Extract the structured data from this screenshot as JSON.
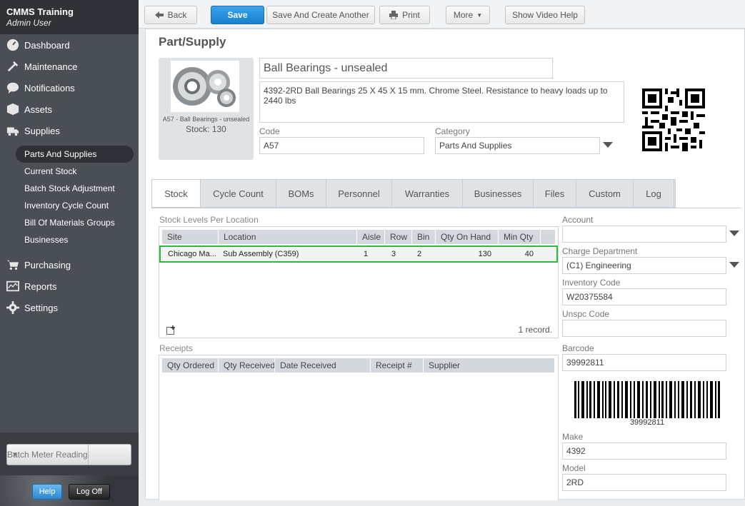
{
  "sidebar": {
    "app_name": "CMMS Training",
    "user": "Admin User",
    "nav": [
      {
        "label": "Dashboard",
        "icon": "dashboard-icon"
      },
      {
        "label": "Maintenance",
        "icon": "tools-icon"
      },
      {
        "label": "Notifications",
        "icon": "chat-bubble-icon"
      },
      {
        "label": "Assets",
        "icon": "box-icon"
      },
      {
        "label": "Supplies",
        "icon": "truck-icon"
      }
    ],
    "supplies_sub": [
      "Parts And Supplies",
      "Current Stock",
      "Batch Stock Adjustment",
      "Inventory Cycle Count",
      "Bill Of Materials Groups",
      "Businesses"
    ],
    "nav2": [
      {
        "label": "Purchasing",
        "icon": "cart-icon"
      },
      {
        "label": "Reports",
        "icon": "chart-icon"
      },
      {
        "label": "Settings",
        "icon": "gear-icon"
      }
    ],
    "batch_meter": "Batch Meter Reading",
    "help": "Help",
    "logoff": "Log Off"
  },
  "toolbar": {
    "back": "Back",
    "save": "Save",
    "save_create": "Save And Create Another",
    "print": "Print",
    "more": "More",
    "video_help": "Show Video Help"
  },
  "page": {
    "title": "Part/Supply",
    "photo_caption": "A57 - Ball Bearings - unsealed",
    "photo_stock": "Stock: 130",
    "name": "Ball Bearings - unsealed",
    "description": "4392-2RD Ball Bearings 25 X 45 X 15 mm. Chrome Steel. Resistance to heavy loads up to 2440 lbs",
    "code_label": "Code",
    "code": "A57",
    "category_label": "Category",
    "category": "Parts And Supplies"
  },
  "tabs": [
    "Stock",
    "Cycle Count",
    "BOMs",
    "Personnel",
    "Warranties",
    "Businesses",
    "Files",
    "Custom",
    "Log"
  ],
  "stock": {
    "section_label": "Stock Levels Per Location",
    "columns": [
      "Site",
      "Location",
      "Aisle",
      "Row",
      "Bin",
      "Qty On Hand",
      "Min Qty"
    ],
    "rows": [
      {
        "site": "Chicago Ma...",
        "location": "Sub Assembly (C359)",
        "aisle": "1",
        "row": "3",
        "bin": "2",
        "qty_on_hand": "130",
        "min_qty": "40"
      }
    ],
    "record_count": "1 record."
  },
  "receipts": {
    "section_label": "Receipts",
    "columns": [
      "Qty Ordered",
      "Qty Received",
      "Date Received",
      "Receipt #",
      "Supplier"
    ]
  },
  "right": {
    "account_label": "Account",
    "account": "",
    "charge_dept_label": "Charge Department",
    "charge_dept": "(C1) Engineering",
    "inventory_code_label": "Inventory Code",
    "inventory_code": "W20375584",
    "unspc_label": "Unspc Code",
    "unspc": "",
    "barcode_label": "Barcode",
    "barcode": "39992811",
    "barcode_text": "39992811",
    "make_label": "Make",
    "make": "4392",
    "model_label": "Model",
    "model": "2RD"
  }
}
